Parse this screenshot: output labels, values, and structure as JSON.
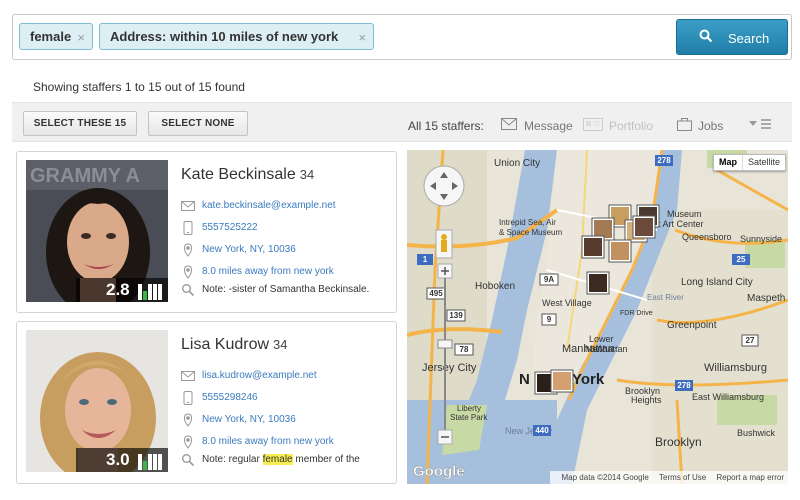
{
  "search": {
    "filters": [
      {
        "label": "female",
        "remove": "×"
      },
      {
        "label": "Address: within 10 miles of new york",
        "remove": "×"
      }
    ],
    "button_label": "Search"
  },
  "results": {
    "summary": "Showing staffers 1 to 15 out of 15 found"
  },
  "toolbar": {
    "select_all_label": "SELECT THESE 15",
    "select_none_label": "SELECT NONE",
    "all_count_label": "All 15 staffers:",
    "message_label": "Message",
    "portfolio_label": "Portfolio",
    "jobs_label": "Jobs"
  },
  "staffers": [
    {
      "name": "Kate Beckinsale",
      "age": "34",
      "rating": "2.8",
      "email": "kate.beckinsale@example.net",
      "phone": "5557525222",
      "location": "New York, NY, 10036",
      "distance": "8.0 miles away from new york",
      "note": "Note: -sister of Samantha Beckinsale.",
      "photo_text": "GRAMMY A"
    },
    {
      "name": "Lisa Kudrow",
      "age": "34",
      "rating": "3.0",
      "email": "lisa.kudrow@example.net",
      "phone": "5555298246",
      "location": "New York, NY, 10036",
      "distance": "8.0 miles away from new york",
      "note_before": "Note: regular ",
      "note_highlight": "female",
      "note_after": " member of the"
    }
  ],
  "map": {
    "type_map": "Map",
    "type_satellite": "Satellite",
    "footer_data": "Map data ©2014 Google",
    "footer_terms": "Terms of Use",
    "footer_report": "Report a map error",
    "google_logo": "Google",
    "labels": {
      "union_city": "Union City",
      "intrepid": "Intrepid Sea, Air",
      "space_museum": "& Space Museum",
      "hoboken": "Hoboken",
      "west_village": "West Village",
      "manhattan": "Manhattan",
      "lower_manhattan_1": "Lower",
      "lower_manhattan_2": "Manhattan",
      "ny_1": "N",
      "ny_2": "York",
      "jersey_city": "Jersey City",
      "liberty_1": "Liberty",
      "liberty_2": "State Park",
      "new_jersey": "New Jersey",
      "brooklyn_1": "Brooklyn",
      "brooklyn_2": "Heights",
      "brooklyn_3": "Brooklyn",
      "williamsburg": "Williamsburg",
      "maspeth": "Maspeth",
      "long_island_city": "Long Island City",
      "greenpoint": "Greenpoint",
      "east_williamsburg": "East Williamsburg",
      "bushwick": "Bushwick",
      "museum": "Museum",
      "art_center": "ort Art Center",
      "queensboro": "Queensboro",
      "east_river": "East River",
      "sunnyside": "Sunnyside",
      "fdr_drive": "FDR Drive",
      "r25": "25",
      "r278": "278",
      "r139": "139",
      "r1": "1",
      "r9a": "9A",
      "r495": "495",
      "r440": "440",
      "r78": "78",
      "r9": "9",
      "r27": "27"
    }
  },
  "colors": {
    "chip_bg": "#ddeef5",
    "chip_border": "#7fbbd3",
    "search_button": "#217ea8",
    "link": "#3a7bbf",
    "rating_green": "#3bb54a",
    "note_highlight": "#f6ee50"
  }
}
